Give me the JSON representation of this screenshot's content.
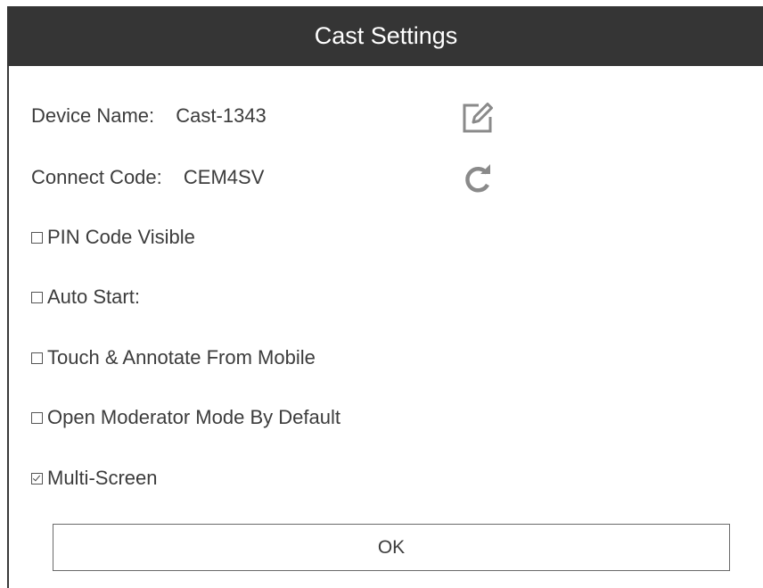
{
  "dialog": {
    "title": "Cast Settings"
  },
  "device": {
    "label": "Device Name:",
    "value": "Cast-1343",
    "action_icon": "edit-icon"
  },
  "connect": {
    "label": "Connect Code:",
    "value": "CEM4SV",
    "action_icon": "refresh-icon"
  },
  "options": [
    {
      "label": "PIN Code Visible",
      "checked": false
    },
    {
      "label": "Auto Start:",
      "checked": false
    },
    {
      "label": "Touch & Annotate From Mobile",
      "checked": false
    },
    {
      "label": "Open Moderator Mode By Default",
      "checked": false
    },
    {
      "label": "Multi-Screen",
      "checked": true
    }
  ],
  "buttons": {
    "ok_label": "OK"
  },
  "colors": {
    "titlebar": "#353535",
    "text": "#3c3c3c",
    "icon": "#8a8a8a"
  }
}
